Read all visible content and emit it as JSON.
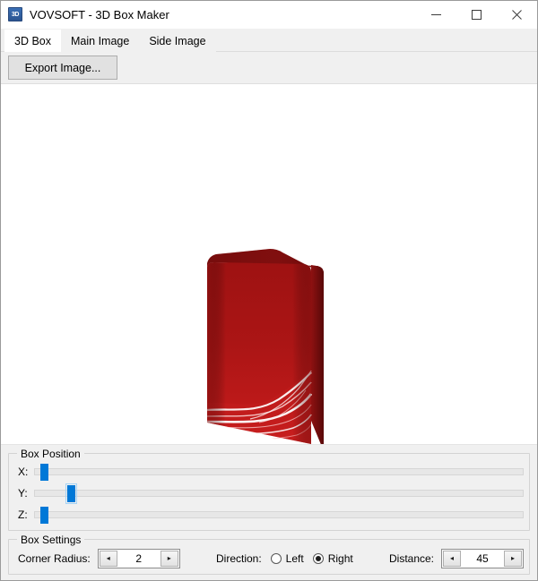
{
  "window": {
    "app_icon_text": "3D",
    "title": "VOVSOFT - 3D Box Maker",
    "controls": {
      "minimize": "minimize-icon",
      "maximize": "maximize-icon",
      "close": "close-icon"
    }
  },
  "tabs": [
    {
      "label": "3D Box",
      "active": true
    },
    {
      "label": "Main Image",
      "active": false
    },
    {
      "label": "Side Image",
      "active": false
    }
  ],
  "toolbar": {
    "export_label": "Export Image..."
  },
  "canvas": {
    "render_description": "3D red software box preview with white light-wave artwork",
    "colors": {
      "front_top": "#a81414",
      "front_bottom": "#c01818",
      "spine": "#7d0f0f",
      "top_face": "#8b1212",
      "highlight": "#ffffff"
    }
  },
  "box_position": {
    "legend": "Box Position",
    "sliders": [
      {
        "label": "X:",
        "value": 2,
        "min": 0,
        "max": 100,
        "percent": 1.2,
        "focused": false
      },
      {
        "label": "Y:",
        "value": 7,
        "min": 0,
        "max": 100,
        "percent": 6.8,
        "focused": true
      },
      {
        "label": "Z:",
        "value": 2,
        "min": 0,
        "max": 100,
        "percent": 1.2,
        "focused": false
      }
    ]
  },
  "box_settings": {
    "legend": "Box Settings",
    "corner_radius": {
      "label": "Corner Radius:",
      "value": "2",
      "dec_icon": "◂",
      "inc_icon": "▸"
    },
    "direction": {
      "label": "Direction:",
      "options": [
        {
          "label": "Left",
          "selected": false
        },
        {
          "label": "Right",
          "selected": true
        }
      ]
    },
    "distance": {
      "label": "Distance:",
      "value": "45",
      "dec_icon": "◂",
      "inc_icon": "▸"
    }
  }
}
